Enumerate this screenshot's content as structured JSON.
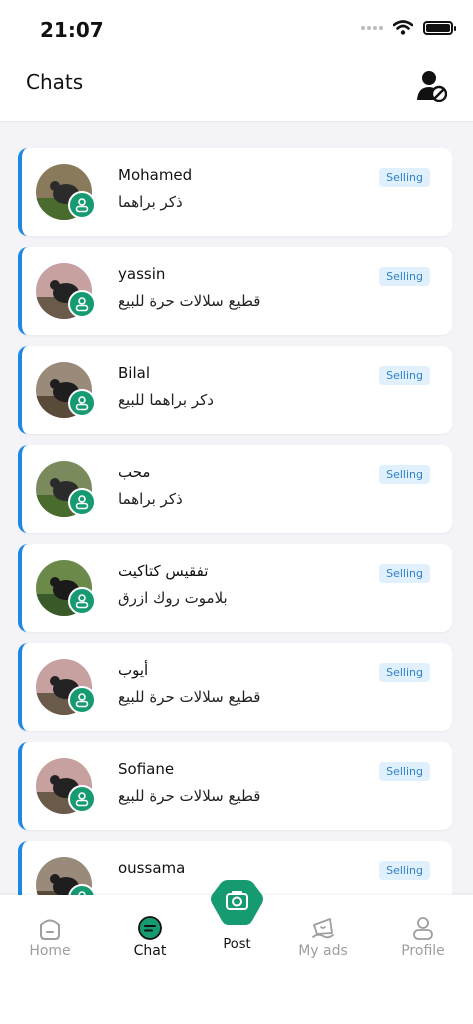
{
  "status_bar": {
    "time": "21:07"
  },
  "header": {
    "title": "Chats"
  },
  "chats": [
    {
      "name": "Mohamed",
      "message": "ذكر براهما",
      "tag": "Selling"
    },
    {
      "name": "yassin",
      "message": "قطيع سلالات حرة للبيع",
      "tag": "Selling"
    },
    {
      "name": "Bilal",
      "message": "دكر براهما للبيع",
      "tag": "Selling"
    },
    {
      "name": "محب",
      "message": "ذكر براهما",
      "tag": "Selling"
    },
    {
      "name": "تفقيس كتاكيت",
      "message": "بلاموت روك ازرق",
      "tag": "Selling"
    },
    {
      "name": "أيوب",
      "message": "قطيع سلالات حرة للبيع",
      "tag": "Selling"
    },
    {
      "name": "Sofiane",
      "message": "قطيع سلالات حرة للبيع",
      "tag": "Selling"
    },
    {
      "name": "oussama",
      "message": "",
      "tag": "Selling"
    }
  ],
  "nav": {
    "home": "Home",
    "chat": "Chat",
    "post": "Post",
    "my_ads": "My ads",
    "profile": "Profile"
  },
  "colors": {
    "accent": "#1e88e5",
    "brand_green": "#159a72",
    "tag_bg": "#e0f0fc",
    "tag_text": "#2f80c9"
  }
}
